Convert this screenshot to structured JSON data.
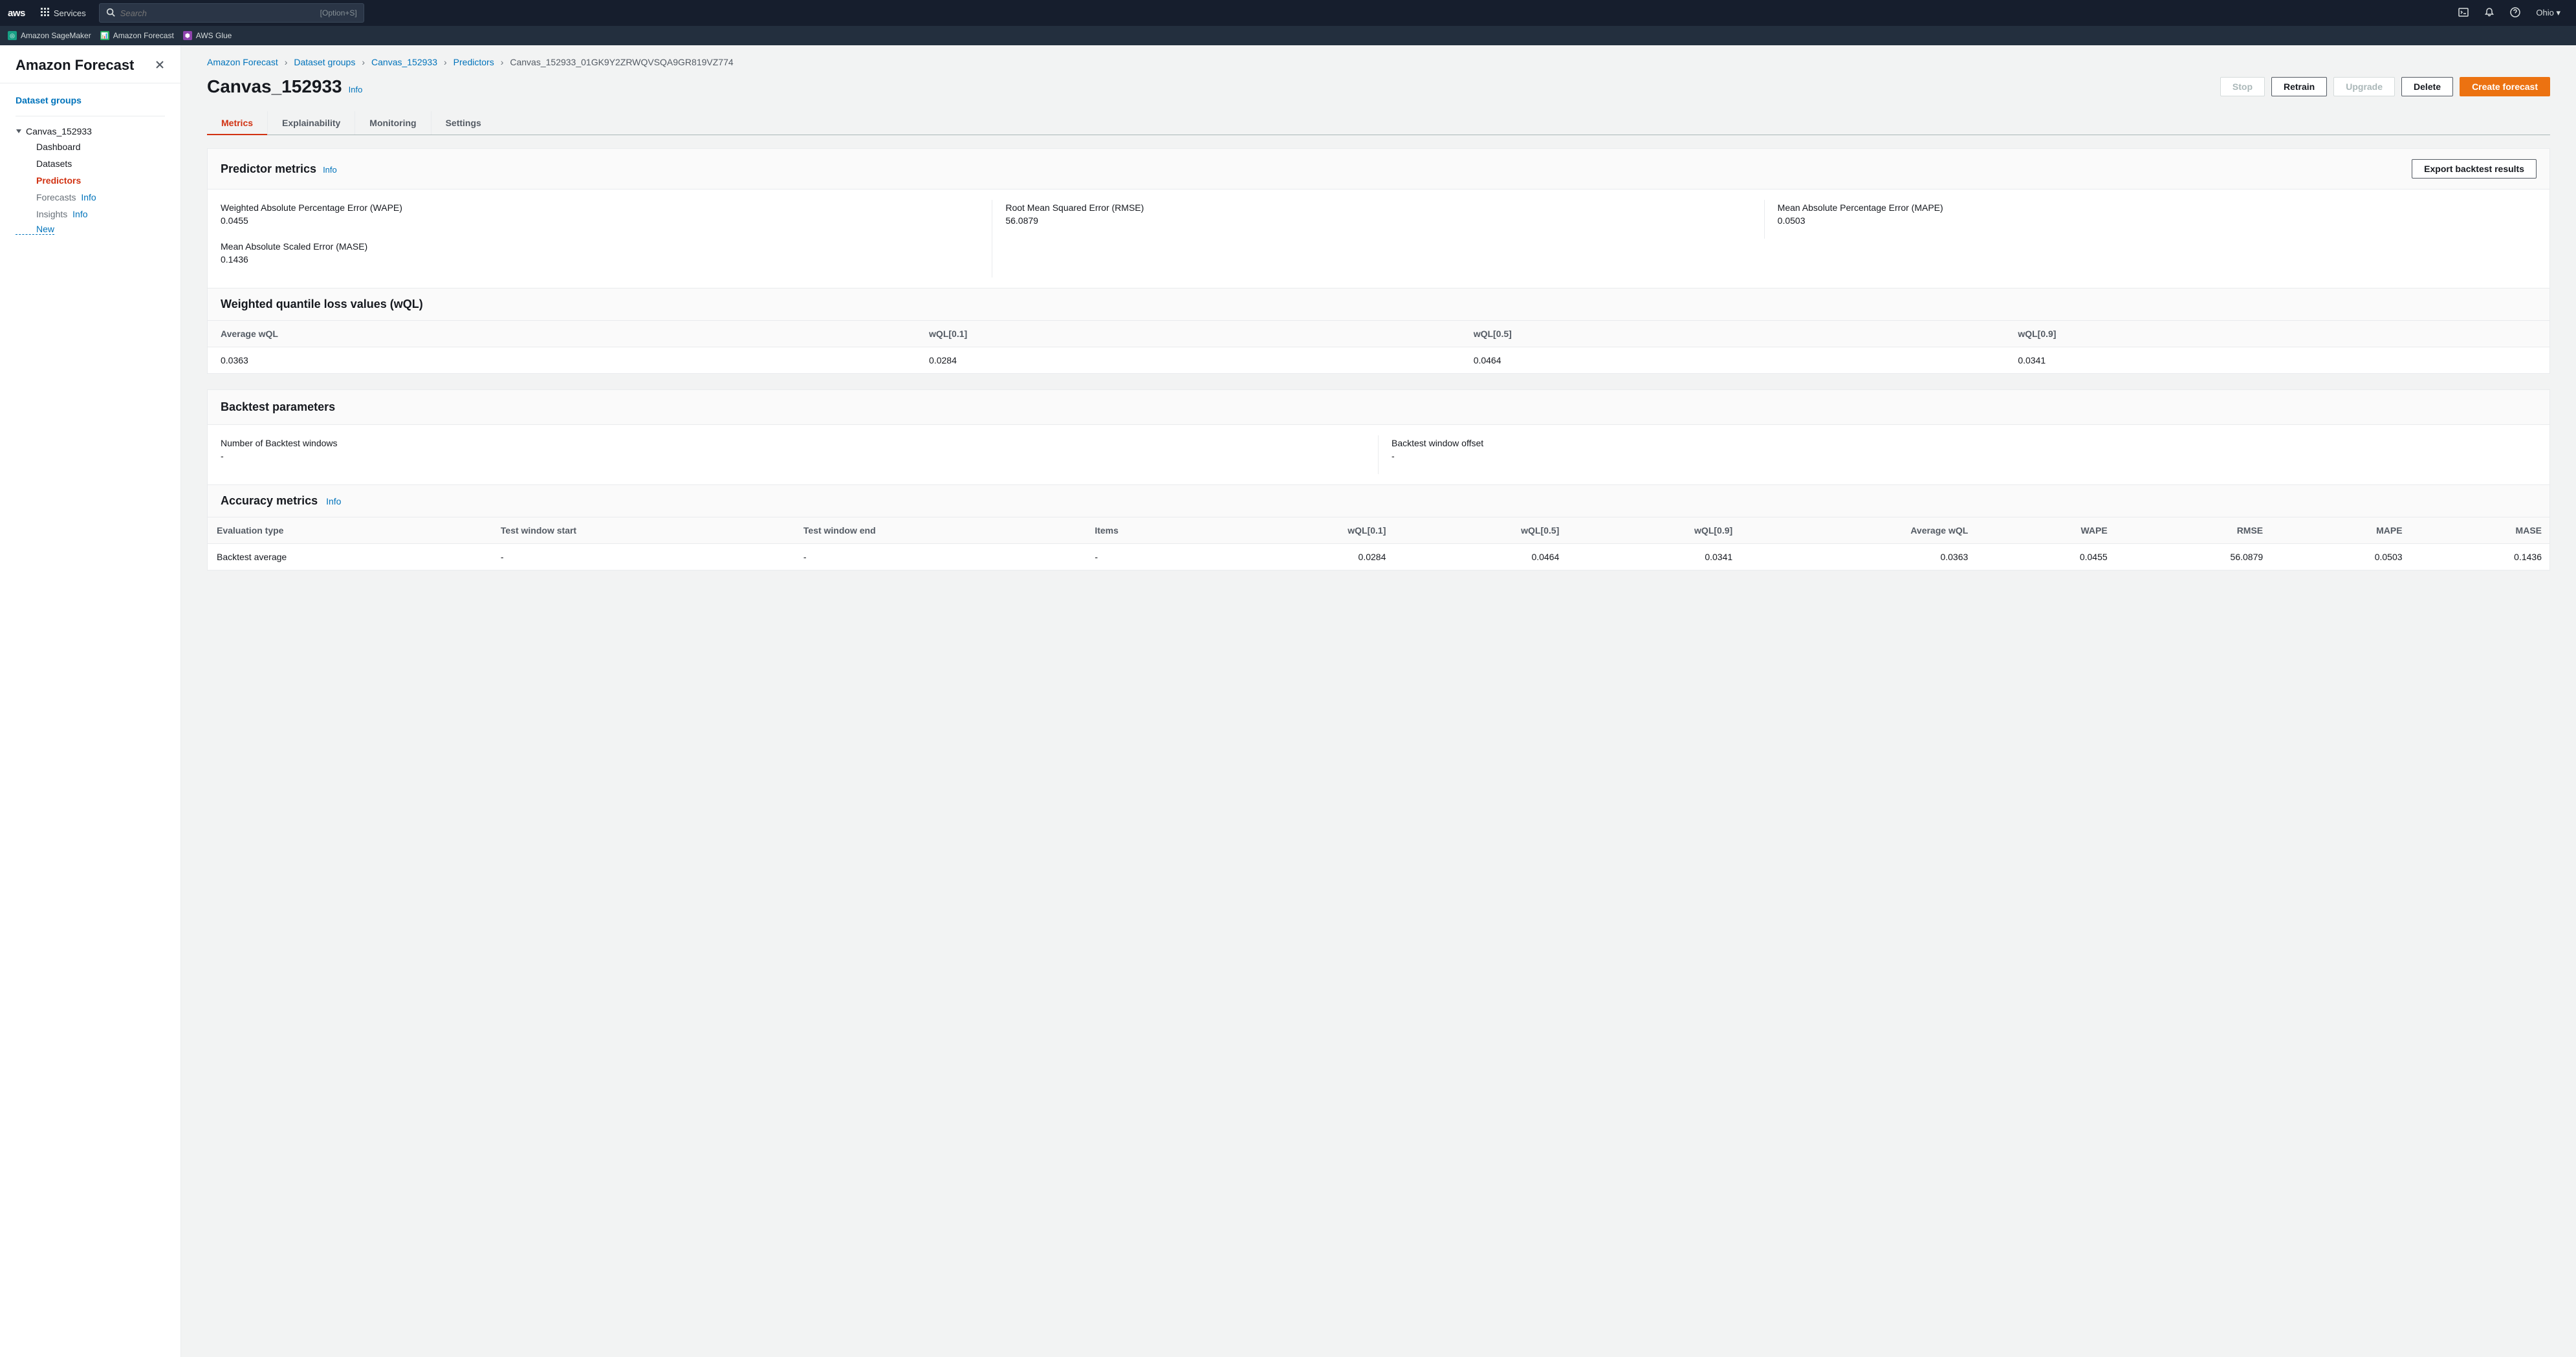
{
  "topnav": {
    "services": "Services",
    "search_placeholder": "Search",
    "search_hint": "[Option+S]",
    "region": "Ohio"
  },
  "favorites": [
    {
      "label": "Amazon SageMaker",
      "color": "teal"
    },
    {
      "label": "Amazon Forecast",
      "color": "green"
    },
    {
      "label": "AWS Glue",
      "color": "purple"
    }
  ],
  "sidebar": {
    "title": "Amazon Forecast",
    "dataset_groups": "Dataset groups",
    "group_name": "Canvas_152933",
    "items": {
      "dashboard": "Dashboard",
      "datasets": "Datasets",
      "predictors": "Predictors",
      "forecasts": "Forecasts",
      "forecasts_info": "Info",
      "insights": "Insights",
      "insights_info": "Info"
    },
    "new_label": "New"
  },
  "breadcrumb": {
    "p1": "Amazon Forecast",
    "p2": "Dataset groups",
    "p3": "Canvas_152933",
    "p4": "Predictors",
    "current": "Canvas_152933_01GK9Y2ZRWQVSQA9GR819VZ774"
  },
  "page": {
    "title": "Canvas_152933",
    "info": "Info",
    "actions": {
      "stop": "Stop",
      "retrain": "Retrain",
      "upgrade": "Upgrade",
      "delete": "Delete",
      "create": "Create forecast"
    }
  },
  "tabs": {
    "metrics": "Metrics",
    "explain": "Explainability",
    "monitor": "Monitoring",
    "settings": "Settings"
  },
  "predictor_metrics": {
    "title": "Predictor metrics",
    "info": "Info",
    "export_btn": "Export backtest results",
    "wape_label": "Weighted Absolute Percentage Error (WAPE)",
    "wape_value": "0.0455",
    "rmse_label": "Root Mean Squared Error (RMSE)",
    "rmse_value": "56.0879",
    "mape_label": "Mean Absolute Percentage Error (MAPE)",
    "mape_value": "0.0503",
    "mase_label": "Mean Absolute Scaled Error (MASE)",
    "mase_value": "0.1436"
  },
  "wql": {
    "title": "Weighted quantile loss values (wQL)",
    "headers": {
      "avg": "Average wQL",
      "p10": "wQL[0.1]",
      "p50": "wQL[0.5]",
      "p90": "wQL[0.9]"
    },
    "row": {
      "avg": "0.0363",
      "p10": "0.0284",
      "p50": "0.0464",
      "p90": "0.0341"
    }
  },
  "backtest": {
    "title": "Backtest parameters",
    "windows_label": "Number of Backtest windows",
    "windows_value": "-",
    "offset_label": "Backtest window offset",
    "offset_value": "-"
  },
  "accuracy": {
    "title": "Accuracy metrics",
    "info": "Info",
    "headers": {
      "eval_type": "Evaluation type",
      "test_start": "Test window start",
      "test_end": "Test window end",
      "items": "Items",
      "wql01": "wQL[0.1]",
      "wql05": "wQL[0.5]",
      "wql09": "wQL[0.9]",
      "avg_wql": "Average wQL",
      "wape": "WAPE",
      "rmse": "RMSE",
      "mape": "MAPE",
      "mase": "MASE"
    },
    "row": {
      "eval_type": "Backtest average",
      "test_start": "-",
      "test_end": "-",
      "items": "-",
      "wql01": "0.0284",
      "wql05": "0.0464",
      "wql09": "0.0341",
      "avg_wql": "0.0363",
      "wape": "0.0455",
      "rmse": "56.0879",
      "mape": "0.0503",
      "mase": "0.1436"
    }
  }
}
